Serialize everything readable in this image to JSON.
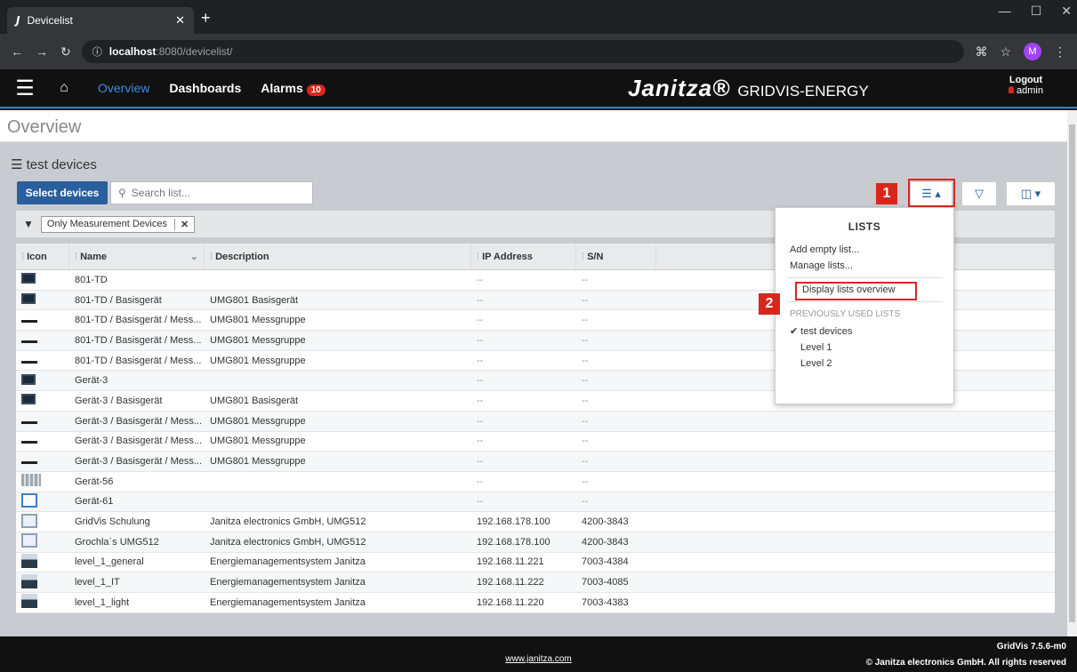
{
  "browser": {
    "tab_title": "Devicelist",
    "tab_favicon": "J",
    "url_host": "localhost",
    "url_path": ":8080/devicelist/",
    "profile_initial": "M"
  },
  "header": {
    "nav": {
      "overview": "Overview",
      "dashboards": "Dashboards",
      "alarms": "Alarms",
      "alarms_count": "10"
    },
    "logo": "Janitza",
    "logo_sub": "GRIDVIS-ENERGY",
    "logout": "Logout",
    "user": "admin"
  },
  "page": {
    "title": "Overview",
    "list_title": "test devices",
    "select_devices": "Select devices",
    "search_placeholder": "Search list...",
    "filter_chip": "Only Measurement Devices"
  },
  "table": {
    "columns": [
      "Icon",
      "Name",
      "Description",
      "IP Address",
      "S/N"
    ],
    "rows": [
      {
        "icon": "box",
        "name": "801-TD",
        "desc": "",
        "ip": "--",
        "sn": "--"
      },
      {
        "icon": "box",
        "name": "801-TD / Basisgerät",
        "desc": "UMG801 Basisgerät",
        "ip": "--",
        "sn": "--"
      },
      {
        "icon": "bar",
        "name": "801-TD / Basisgerät / Mess...",
        "desc": "UMG801 Messgruppe",
        "ip": "--",
        "sn": "--"
      },
      {
        "icon": "bar",
        "name": "801-TD / Basisgerät / Mess...",
        "desc": "UMG801 Messgruppe",
        "ip": "--",
        "sn": "--"
      },
      {
        "icon": "bar",
        "name": "801-TD / Basisgerät / Mess...",
        "desc": "UMG801 Messgruppe",
        "ip": "--",
        "sn": "--"
      },
      {
        "icon": "box",
        "name": "Gerät-3",
        "desc": "",
        "ip": "--",
        "sn": "--"
      },
      {
        "icon": "box",
        "name": "Gerät-3 / Basisgerät",
        "desc": "UMG801 Basisgerät",
        "ip": "--",
        "sn": "--"
      },
      {
        "icon": "bar",
        "name": "Gerät-3 / Basisgerät / Mess...",
        "desc": "UMG801 Messgruppe",
        "ip": "--",
        "sn": "--"
      },
      {
        "icon": "bar",
        "name": "Gerät-3 / Basisgerät / Mess...",
        "desc": "UMG801 Messgruppe",
        "ip": "--",
        "sn": "--"
      },
      {
        "icon": "bar",
        "name": "Gerät-3 / Basisgerät / Mess...",
        "desc": "UMG801 Messgruppe",
        "ip": "--",
        "sn": "--"
      },
      {
        "icon": "rack",
        "name": "Gerät-56",
        "desc": "",
        "ip": "--",
        "sn": "--"
      },
      {
        "icon": "screen",
        "name": "Gerät-61",
        "desc": "",
        "ip": "--",
        "sn": "--"
      },
      {
        "icon": "screen2",
        "name": "GridVis Schulung",
        "desc": "Janitza electronics GmbH, UMG512",
        "ip": "192.168.178.100",
        "sn": "4200-3843"
      },
      {
        "icon": "screen2",
        "name": "Grochla´s UMG512",
        "desc": "Janitza electronics GmbH, UMG512",
        "ip": "192.168.178.100",
        "sn": "4200-3843"
      },
      {
        "icon": "umg",
        "name": "level_1_general",
        "desc": "Energiemanagementsystem Janitza",
        "ip": "192.168.11.221",
        "sn": "7003-4384"
      },
      {
        "icon": "umg",
        "name": "level_1_IT",
        "desc": "Energiemanagementsystem Janitza",
        "ip": "192.168.11.222",
        "sn": "7003-4085"
      },
      {
        "icon": "umg",
        "name": "level_1_light",
        "desc": "Energiemanagementsystem Janitza",
        "ip": "192.168.11.220",
        "sn": "7003-4383"
      }
    ]
  },
  "dropdown": {
    "title": "LISTS",
    "add_empty": "Add empty list...",
    "manage": "Manage lists...",
    "display_overview": "Display lists overview",
    "previously_used": "PREVIOUSLY USED LISTS",
    "lists": [
      "test devices",
      "Level 1",
      "Level 2"
    ]
  },
  "steps": {
    "one": "1",
    "two": "2"
  },
  "footer": {
    "url": "www.janitza.com",
    "version": "GridVis 7.5.6-m0",
    "copyright": "© Janitza electronics GmbH. All rights reserved"
  },
  "colors": {
    "accent": "#3a7fc4",
    "highlight": "#d9261c",
    "primary_button": "#2a5f9e"
  }
}
